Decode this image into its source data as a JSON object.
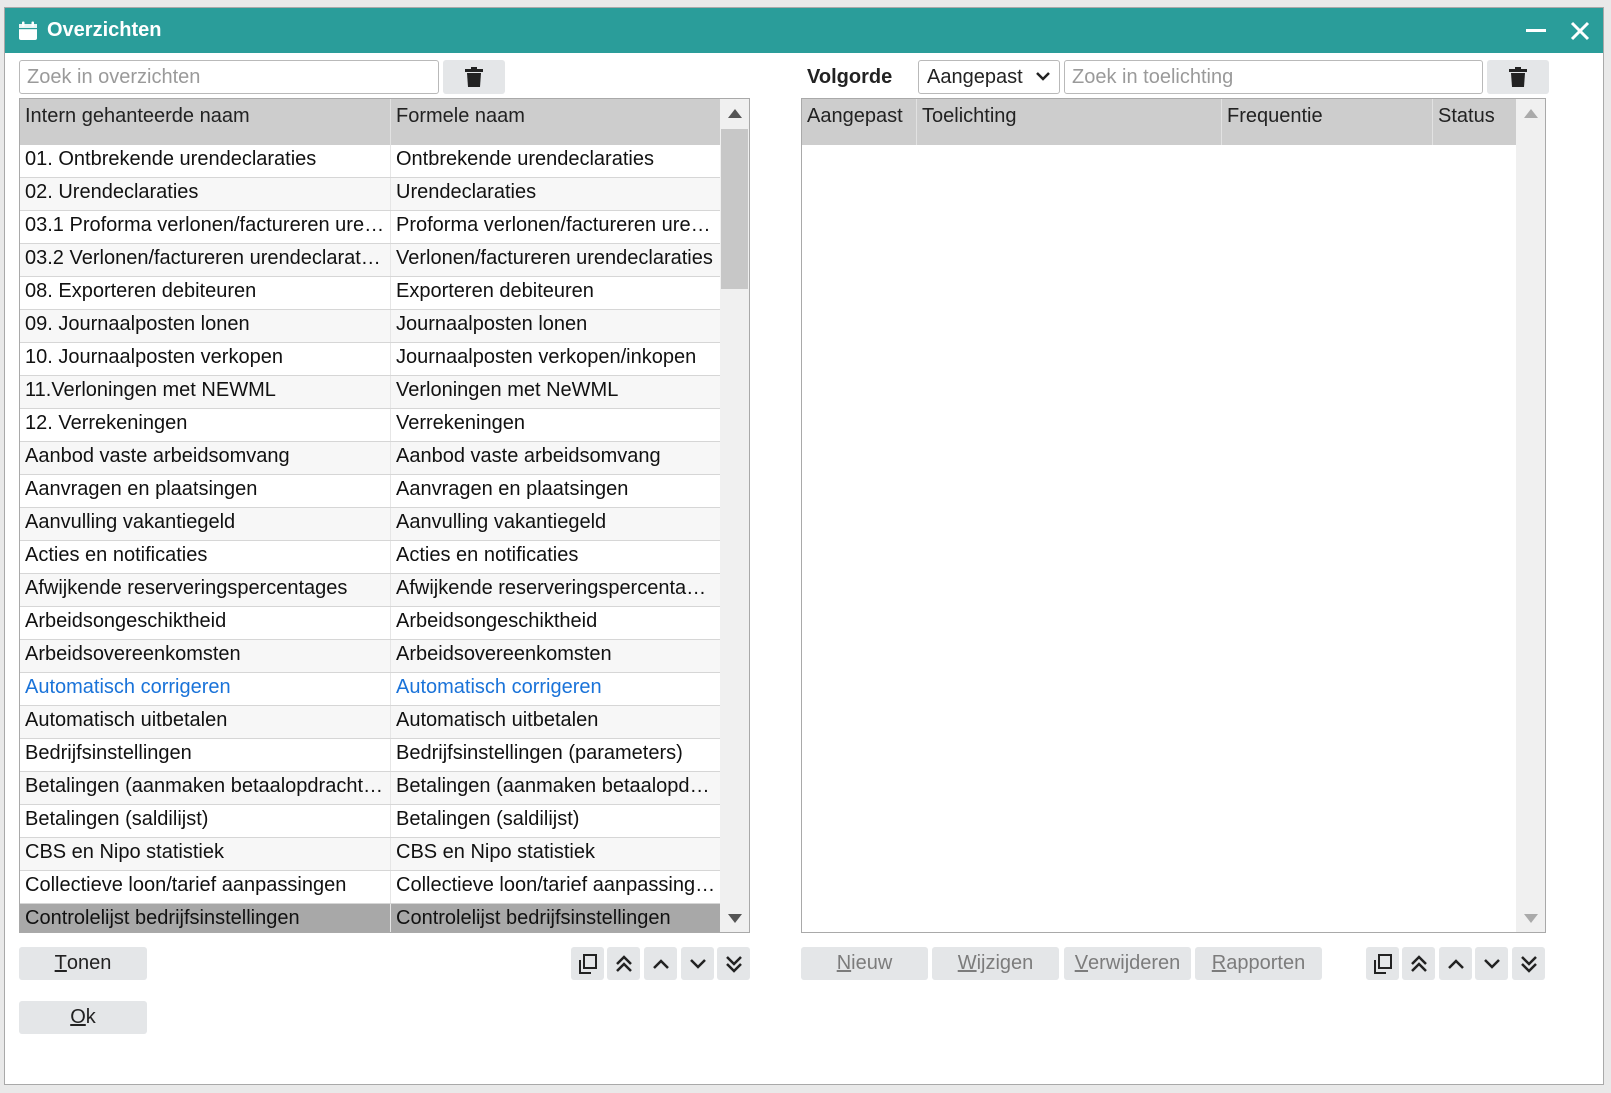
{
  "window": {
    "title": "Overzichten"
  },
  "left": {
    "search_placeholder": "Zoek in overzichten",
    "columns": [
      "Intern gehanteerde naam",
      "Formele naam"
    ],
    "rows": [
      [
        "01. Ontbrekende urendeclaraties",
        "Ontbrekende urendeclaraties"
      ],
      [
        "02. Urendeclaraties",
        "Urendeclaraties"
      ],
      [
        "03.1 Proforma verlonen/factureren uren…",
        "Proforma verlonen/factureren uren…"
      ],
      [
        "03.2 Verlonen/factureren urendeclaraties",
        "Verlonen/factureren urendeclaraties"
      ],
      [
        "08. Exporteren debiteuren",
        "Exporteren debiteuren"
      ],
      [
        "09. Journaalposten lonen",
        "Journaalposten lonen"
      ],
      [
        "10. Journaalposten verkopen",
        "Journaalposten verkopen/inkopen"
      ],
      [
        "11.Verloningen met NEWML",
        "Verloningen met NeWML"
      ],
      [
        "12. Verrekeningen",
        "Verrekeningen"
      ],
      [
        "Aanbod vaste arbeidsomvang",
        "Aanbod vaste arbeidsomvang"
      ],
      [
        "Aanvragen en plaatsingen",
        "Aanvragen en plaatsingen"
      ],
      [
        "Aanvulling vakantiegeld",
        "Aanvulling vakantiegeld"
      ],
      [
        "Acties en notificaties",
        "Acties en notificaties"
      ],
      [
        "Afwijkende reserveringspercentages",
        "Afwijkende reserveringspercentages"
      ],
      [
        "Arbeidsongeschiktheid",
        "Arbeidsongeschiktheid"
      ],
      [
        "Arbeidsovereenkomsten",
        "Arbeidsovereenkomsten"
      ],
      [
        "Automatisch corrigeren",
        "Automatisch corrigeren"
      ],
      [
        "Automatisch uitbetalen",
        "Automatisch uitbetalen"
      ],
      [
        "Bedrijfsinstellingen",
        "Bedrijfsinstellingen (parameters)"
      ],
      [
        "Betalingen (aanmaken betaalopdrachten)",
        "Betalingen (aanmaken betaalopdra…"
      ],
      [
        "Betalingen (saldilijst)",
        "Betalingen (saldilijst)"
      ],
      [
        "CBS en Nipo statistiek",
        "CBS en Nipo statistiek"
      ],
      [
        "Collectieve loon/tarief aanpassingen",
        "Collectieve loon/tarief aanpassingen"
      ],
      [
        "Controlelijst bedrijfsinstellingen",
        "Controlelijst bedrijfsinstellingen"
      ]
    ],
    "link_row_index": 16,
    "selected_row_index": 23,
    "tonen_prefix": "T",
    "tonen_rest": "onen",
    "ok_prefix": "O",
    "ok_rest": "k"
  },
  "right": {
    "volgorde_label": "Volgorde",
    "volgorde_value": "Aangepast",
    "search_placeholder": "Zoek in toelichting",
    "columns": [
      "Aangepast",
      "Toelichting",
      "Frequentie",
      "Status"
    ],
    "buttons": {
      "nieuw": {
        "u": "N",
        "rest": "ieuw"
      },
      "wijzigen": {
        "u": "W",
        "rest": "ijzigen"
      },
      "verwijderen": {
        "u": "V",
        "rest": "erwijderen"
      },
      "rapporten": {
        "u": "R",
        "rest": "apporten"
      }
    }
  },
  "colors": {
    "titlebar": "#2a9d9a",
    "link": "#1a73d9",
    "selected_row": "#a8a8a8",
    "header": "#cdcdcd"
  },
  "icons": [
    "calendar-icon",
    "minimize-icon",
    "close-icon",
    "trash-icon",
    "copy-icon",
    "move-top-icon",
    "move-up-icon",
    "move-down-icon",
    "move-bottom-icon",
    "chevron-down-icon",
    "scroll-up-icon",
    "scroll-down-icon"
  ]
}
